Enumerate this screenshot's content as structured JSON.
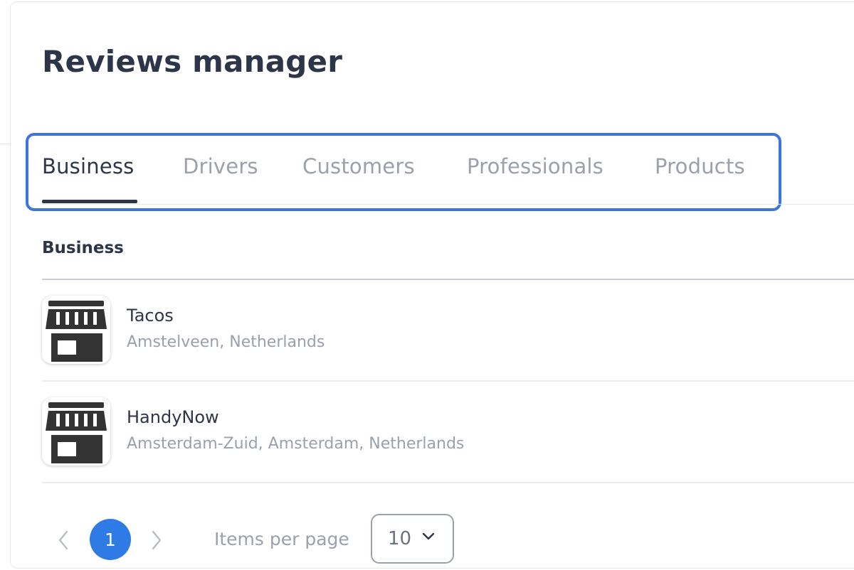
{
  "page": {
    "title": "Reviews manager"
  },
  "tabs": [
    {
      "label": "Business",
      "active": true
    },
    {
      "label": "Drivers",
      "active": false
    },
    {
      "label": "Customers",
      "active": false
    },
    {
      "label": "Professionals",
      "active": false
    },
    {
      "label": "Products",
      "active": false
    }
  ],
  "list": {
    "header": "Business",
    "items": [
      {
        "name": "Tacos",
        "location": "Amstelveen, Netherlands",
        "icon": "store-icon"
      },
      {
        "name": "HandyNow",
        "location": "Amsterdam-Zuid, Amsterdam, Netherlands",
        "icon": "store-icon"
      }
    ]
  },
  "pagination": {
    "current_page": "1",
    "items_per_page_label": "Items per page",
    "items_per_page_value": "10"
  },
  "colors": {
    "accent": "#2f7be6",
    "highlight_border": "#3d74e0",
    "text_primary": "#2c3648",
    "text_muted": "#9aa1ad"
  }
}
